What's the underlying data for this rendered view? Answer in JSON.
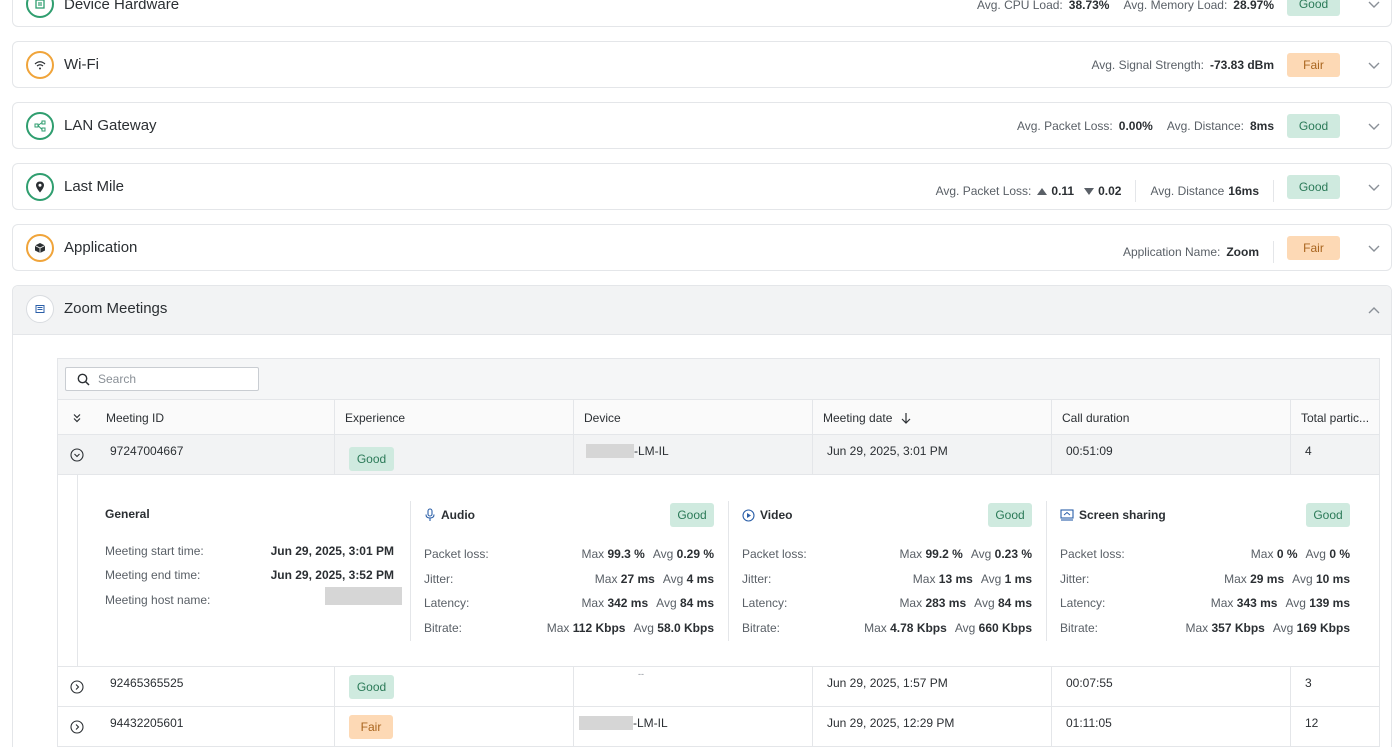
{
  "cards": [
    {
      "title": "Device Hardware",
      "metrics": [
        {
          "label": "Avg. CPU Load:",
          "value": "38.73%"
        },
        {
          "label": "Avg. Memory Load:",
          "value": "28.97%"
        }
      ],
      "status": "Good"
    },
    {
      "title": "Wi-Fi",
      "metrics": [
        {
          "label": "Avg. Signal Strength:",
          "value": "-73.83 dBm"
        }
      ],
      "status": "Fair"
    },
    {
      "title": "LAN Gateway",
      "metrics": [
        {
          "label": "Avg. Packet Loss:",
          "value": "0.00%"
        },
        {
          "label": "Avg. Distance:",
          "value": "8ms"
        }
      ],
      "status": "Good"
    },
    {
      "title": "Last Mile",
      "packet_loss_label": "Avg. Packet Loss:",
      "packet_loss_up": "0.11",
      "packet_loss_down": "0.02",
      "distance_label": "Avg. Distance",
      "distance_value": "16ms",
      "status": "Good"
    },
    {
      "title": "Application",
      "metrics": [
        {
          "label": "Application Name:",
          "value": "Zoom"
        }
      ],
      "status": "Fair"
    }
  ],
  "zoom": {
    "title": "Zoom Meetings",
    "search_placeholder": "Search",
    "columns": [
      "Meeting ID",
      "Experience",
      "Device",
      "Meeting date",
      "Call duration",
      "Total partic..."
    ],
    "rows": [
      {
        "meeting_id": "97247004667",
        "experience": "Good",
        "device": "-LM-IL",
        "date": "Jun 29, 2025, 3:01 PM",
        "duration": "00:51:09",
        "participants": "4"
      },
      {
        "meeting_id": "92465365525",
        "experience": "Good",
        "device": "--",
        "date": "Jun 29, 2025, 1:57 PM",
        "duration": "00:07:55",
        "participants": "3"
      },
      {
        "meeting_id": "94432205601",
        "experience": "Fair",
        "device": "-LM-IL",
        "date": "Jun 29, 2025, 12:29 PM",
        "duration": "01:11:05",
        "participants": "12"
      }
    ],
    "detail": {
      "general": {
        "title": "General",
        "start_label": "Meeting start time:",
        "start_value": "Jun 29, 2025, 3:01 PM",
        "end_label": "Meeting end time:",
        "end_value": "Jun 29, 2025, 3:52 PM",
        "host_label": "Meeting host name:"
      },
      "labels": {
        "packet_loss": "Packet loss:",
        "jitter": "Jitter:",
        "latency": "Latency:",
        "bitrate": "Bitrate:",
        "max": "Max",
        "avg": "Avg"
      },
      "sections": [
        {
          "title": "Audio",
          "icon": "microphone-icon",
          "status": "Good",
          "packet_loss": {
            "max": "99.3 %",
            "avg": "0.29 %"
          },
          "jitter": {
            "max": "27 ms",
            "avg": "4 ms"
          },
          "latency": {
            "max": "342 ms",
            "avg": "84 ms"
          },
          "bitrate": {
            "max": "112 Kbps",
            "avg": "58.0 Kbps"
          }
        },
        {
          "title": "Video",
          "icon": "play-icon",
          "status": "Good",
          "packet_loss": {
            "max": "99.2 %",
            "avg": "0.23 %"
          },
          "jitter": {
            "max": "13 ms",
            "avg": "1 ms"
          },
          "latency": {
            "max": "283 ms",
            "avg": "84 ms"
          },
          "bitrate": {
            "max": "4.78 Kbps",
            "avg": "660 Kbps"
          }
        },
        {
          "title": "Screen sharing",
          "icon": "screen-share-icon",
          "status": "Good",
          "packet_loss": {
            "max": "0 %",
            "avg": "0 %"
          },
          "jitter": {
            "max": "29 ms",
            "avg": "10 ms"
          },
          "latency": {
            "max": "343 ms",
            "avg": "139 ms"
          },
          "bitrate": {
            "max": "357 Kbps",
            "avg": "169 Kbps"
          }
        }
      ]
    }
  },
  "colors": {
    "good_bg": "#cfeadf",
    "good_text": "#2b7a58",
    "fair_bg": "#fdd9b5",
    "fair_text": "#a9651e",
    "good_ring": "#2f9e6f",
    "fair_ring": "#f0a43a"
  }
}
